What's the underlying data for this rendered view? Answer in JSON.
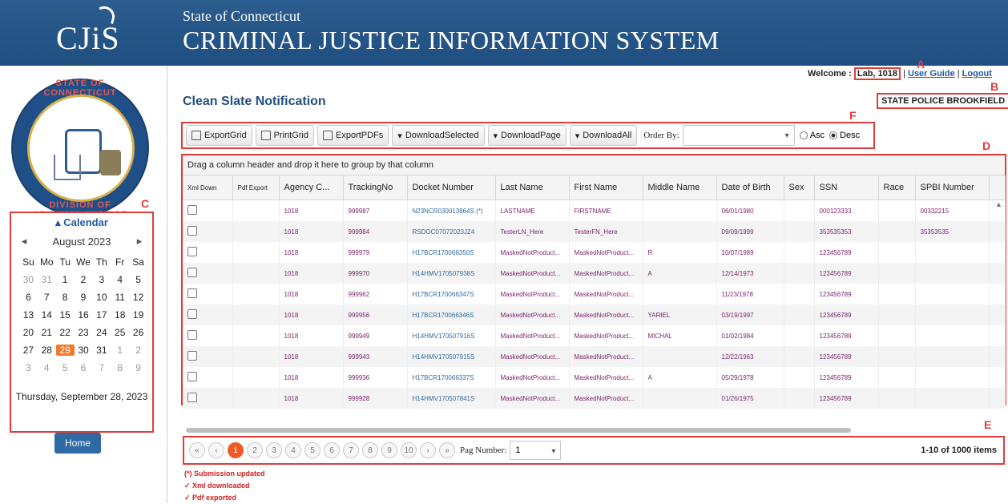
{
  "header": {
    "logo_text": "CJiS",
    "state_line": "State of Connecticut",
    "system_title": "CRIMINAL JUSTICE INFORMATION SYSTEM"
  },
  "seal": {
    "top_text": "STATE OF CONNECTICUT",
    "bottom_text": "DIVISION OF CRIMINAL JUSTICE"
  },
  "user_bar": {
    "welcome_label": "Welcome :",
    "user_name": "Lab, 1018",
    "separator": "|",
    "user_guide": "User Guide",
    "logout": "Logout",
    "organization": "STATE POLICE BROOKFIELD"
  },
  "annotations": {
    "A": "A",
    "B": "B",
    "C": "C",
    "D": "D",
    "E": "E",
    "F": "F"
  },
  "page": {
    "title": "Clean Slate Notification"
  },
  "toolbar": {
    "export_grid": "ExportGrid",
    "print_grid": "PrintGrid",
    "export_pdfs": "ExportPDFs",
    "download_selected": "DownloadSelected",
    "download_page": "DownloadPage",
    "download_all": "DownloadAll",
    "order_by_label": "Order By:",
    "order_by_value": "",
    "asc": "Asc",
    "desc": "Desc"
  },
  "calendar": {
    "title": "Calendar",
    "month": "August 2023",
    "dow": [
      "Su",
      "Mo",
      "Tu",
      "We",
      "Th",
      "Fr",
      "Sa"
    ],
    "days": [
      {
        "d": "30",
        "m": true
      },
      {
        "d": "31",
        "m": true
      },
      {
        "d": "1"
      },
      {
        "d": "2"
      },
      {
        "d": "3"
      },
      {
        "d": "4"
      },
      {
        "d": "5"
      },
      {
        "d": "6"
      },
      {
        "d": "7"
      },
      {
        "d": "8"
      },
      {
        "d": "9"
      },
      {
        "d": "10"
      },
      {
        "d": "11"
      },
      {
        "d": "12"
      },
      {
        "d": "13"
      },
      {
        "d": "14"
      },
      {
        "d": "15"
      },
      {
        "d": "16"
      },
      {
        "d": "17"
      },
      {
        "d": "18"
      },
      {
        "d": "19"
      },
      {
        "d": "20"
      },
      {
        "d": "21"
      },
      {
        "d": "22"
      },
      {
        "d": "23"
      },
      {
        "d": "24"
      },
      {
        "d": "25"
      },
      {
        "d": "26"
      },
      {
        "d": "27"
      },
      {
        "d": "28"
      },
      {
        "d": "29",
        "s": true
      },
      {
        "d": "30"
      },
      {
        "d": "31"
      },
      {
        "d": "1",
        "m": true
      },
      {
        "d": "2",
        "m": true
      },
      {
        "d": "3",
        "m": true
      },
      {
        "d": "4",
        "m": true
      },
      {
        "d": "5",
        "m": true
      },
      {
        "d": "6",
        "m": true
      },
      {
        "d": "7",
        "m": true
      },
      {
        "d": "8",
        "m": true
      },
      {
        "d": "9",
        "m": true
      }
    ],
    "footer": "Thursday, September 28, 2023"
  },
  "home_button": "Home",
  "grid": {
    "grouping_hint": "Drag a column header and drop it here to group by that column",
    "columns": [
      "Xml Down",
      "Pdf Export",
      "Agency C...",
      "TrackingNo",
      "Docket Number",
      "Last Name",
      "First Name",
      "Middle Name",
      "Date of Birth",
      "Sex",
      "SSN",
      "Race",
      "SPBI Number"
    ],
    "rows": [
      [
        "",
        "",
        "1018",
        "999987",
        "N23NCR030013864S (*)",
        "LASTNAME",
        "FIRSTNAME",
        "",
        "06/01/1980",
        "",
        "000123333",
        "",
        "00332215"
      ],
      [
        "",
        "",
        "1018",
        "999984",
        "RSDOC07072023JZ4",
        "TesterLN_Here",
        "TesterFN_Here",
        "",
        "09/09/1999",
        "",
        "353535353",
        "",
        "35353535"
      ],
      [
        "",
        "",
        "1018",
        "999979",
        "H17BCR170066350S",
        "MaskedNotProduct...",
        "MaskedNotProduct...",
        "R",
        "10/07/1989",
        "",
        "123456789",
        "",
        ""
      ],
      [
        "",
        "",
        "1018",
        "999970",
        "H14HMV170507938S",
        "MaskedNotProduct...",
        "MaskedNotProduct...",
        "A",
        "12/14/1973",
        "",
        "123456789",
        "",
        ""
      ],
      [
        "",
        "",
        "1018",
        "999962",
        "H17BCR170066347S",
        "MaskedNotProduct...",
        "MaskedNotProduct...",
        "",
        "11/23/1978",
        "",
        "123456789",
        "",
        ""
      ],
      [
        "",
        "",
        "1018",
        "999956",
        "H17BCR170066346S",
        "MaskedNotProduct...",
        "MaskedNotProduct...",
        "YARIEL",
        "03/19/1997",
        "",
        "123456789",
        "",
        ""
      ],
      [
        "",
        "",
        "1018",
        "999949",
        "H14HMV170507916S",
        "MaskedNotProduct...",
        "MaskedNotProduct...",
        "MICHAL",
        "01/02/1984",
        "",
        "123456789",
        "",
        ""
      ],
      [
        "",
        "",
        "1018",
        "999943",
        "H14HMV170507915S",
        "MaskedNotProduct...",
        "MaskedNotProduct...",
        "",
        "12/22/1963",
        "",
        "123456789",
        "",
        ""
      ],
      [
        "",
        "",
        "1018",
        "999936",
        "H17BCR170066337S",
        "MaskedNotProduct...",
        "MaskedNotProduct...",
        "A",
        "05/29/1978",
        "",
        "123456789",
        "",
        ""
      ],
      [
        "",
        "",
        "1018",
        "999928",
        "H14HMV170507841S",
        "MaskedNotProduct...",
        "MaskedNotProduct...",
        "",
        "01/26/1975",
        "",
        "123456789",
        "",
        ""
      ]
    ]
  },
  "pager": {
    "first": "«",
    "prev": "‹",
    "pages": [
      "1",
      "2",
      "3",
      "4",
      "5",
      "6",
      "7",
      "8",
      "9",
      "10"
    ],
    "active_page": "1",
    "next": "›",
    "last": "»",
    "pag_number_label": "Pag Number:",
    "pag_number_value": "1",
    "items_info": "1-10 of 1000 items"
  },
  "legend": [
    "(*) Submission updated",
    "✓ Xml downloaded",
    "✓ Pdf exported"
  ]
}
